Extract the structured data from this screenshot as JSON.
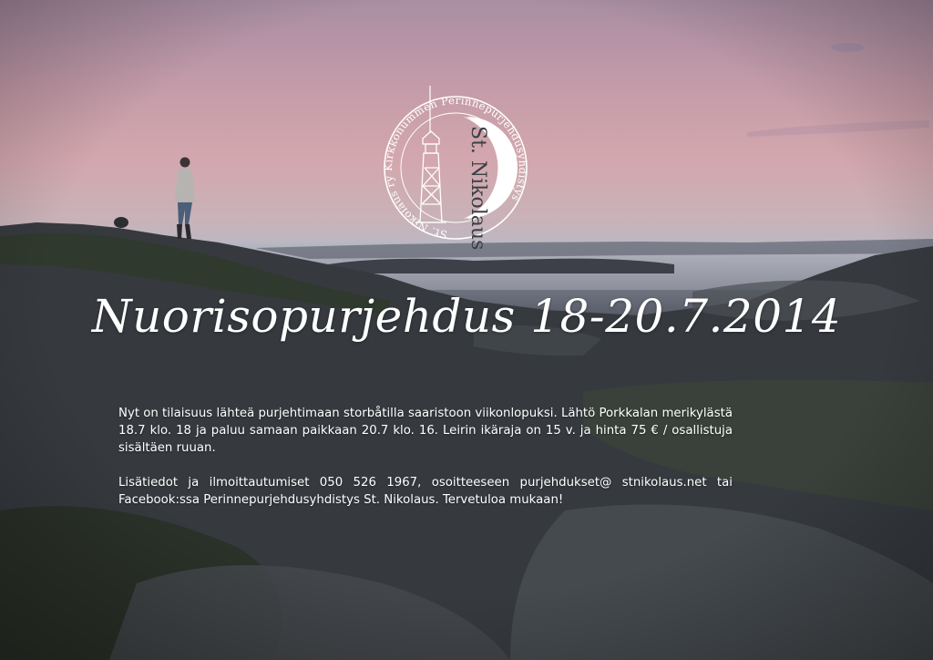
{
  "headline": "Nuorisopurjehdus 18-20.7.2014",
  "paragraphs": [
    "Nyt on tilaisuus lähteä purjehtimaan storbåtilla saaristoon viikonlopuksi. Lähtö Porkkalan merikylästä 18.7 klo. 18 ja paluu samaan paikkaan 20.7 klo. 16. Leirin ikäraja on 15 v. ja hinta 75 € / osallistuja sisältäen ruuan.",
    "Lisätiedot ja ilmoittautumiset 050 526 1967, osoitteeseen purjehdukset@ stnikolaus.net tai Facebook:ssa Perinnepurjehdusyhdistys St. Nikolaus. Tervetuloa mukaan!"
  ],
  "logo": {
    "outer_ring_text": "St. Nikolaus ry Kirkkonummen Perinnepurjehdusyhdistys",
    "inner_text": "St. Nikolaus"
  },
  "colors": {
    "sky_top": "#a98ea3",
    "sky_pink": "#d3a7ad",
    "rock": "#3b3f44",
    "text": "#ffffff"
  }
}
